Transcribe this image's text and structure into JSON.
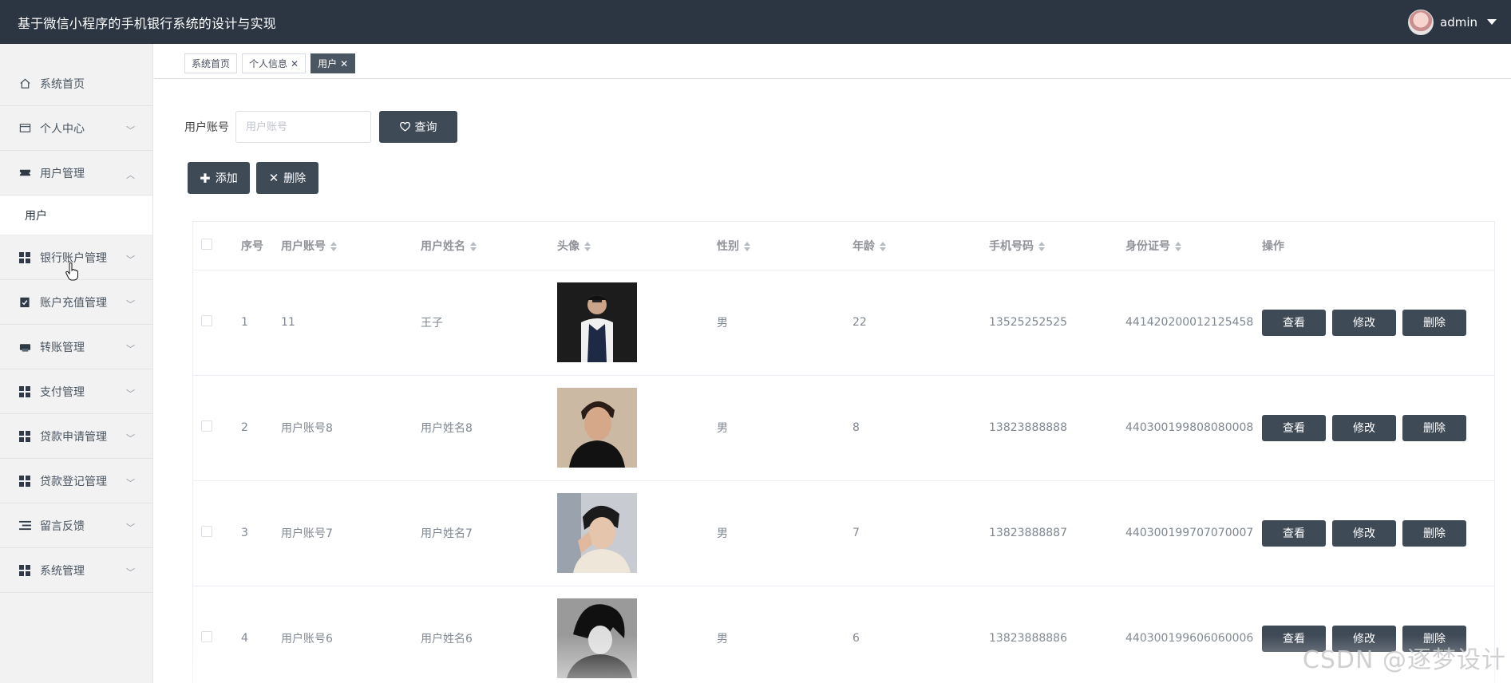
{
  "header": {
    "title": "基于微信小程序的手机银行系统的设计与实现",
    "username": "admin"
  },
  "sidebar": {
    "items": [
      {
        "label": "系统首页",
        "icon": "home-icon"
      },
      {
        "label": "个人中心",
        "icon": "id-card-icon"
      },
      {
        "label": "用户管理",
        "icon": "ticket-icon",
        "expanded": true
      },
      {
        "label": "银行账户管理",
        "icon": "grid-icon"
      },
      {
        "label": "账户充值管理",
        "icon": "clipboard-check-icon"
      },
      {
        "label": "转账管理",
        "icon": "printer-icon"
      },
      {
        "label": "支付管理",
        "icon": "grid-icon"
      },
      {
        "label": "贷款申请管理",
        "icon": "grid-icon"
      },
      {
        "label": "贷款登记管理",
        "icon": "grid-icon"
      },
      {
        "label": "留言反馈",
        "icon": "list-icon"
      },
      {
        "label": "系统管理",
        "icon": "grid-icon"
      }
    ],
    "sub_item": "用户"
  },
  "tabs": [
    {
      "label": "系统首页",
      "closable": false,
      "active": false
    },
    {
      "label": "个人信息",
      "closable": true,
      "active": false
    },
    {
      "label": "用户",
      "closable": true,
      "active": true
    }
  ],
  "search": {
    "label": "用户账号",
    "placeholder": "用户账号",
    "button": "查询"
  },
  "actions": {
    "add": "添加",
    "delete": "删除"
  },
  "table": {
    "columns": [
      "序号",
      "用户账号",
      "用户姓名",
      "头像",
      "性别",
      "年龄",
      "手机号码",
      "身份证号",
      "操作"
    ],
    "rows": [
      {
        "index": "1",
        "account": "11",
        "name": "王子",
        "gender": "男",
        "age": "22",
        "phone": "13525252525",
        "id_card": "441420200012125458"
      },
      {
        "index": "2",
        "account": "用户账号8",
        "name": "用户姓名8",
        "gender": "男",
        "age": "8",
        "phone": "13823888888",
        "id_card": "440300199808080008"
      },
      {
        "index": "3",
        "account": "用户账号7",
        "name": "用户姓名7",
        "gender": "男",
        "age": "7",
        "phone": "13823888887",
        "id_card": "440300199707070007"
      },
      {
        "index": "4",
        "account": "用户账号6",
        "name": "用户姓名6",
        "gender": "男",
        "age": "6",
        "phone": "13823888886",
        "id_card": "440300199606060006"
      }
    ],
    "row_actions": {
      "view": "查看",
      "edit": "修改",
      "delete": "删除"
    }
  },
  "watermark": "CSDN @逐梦设计",
  "colors": {
    "header_bg": "#2b3642",
    "button_dark": "#3f4a57",
    "sidebar_bg": "#f2f2f2"
  }
}
